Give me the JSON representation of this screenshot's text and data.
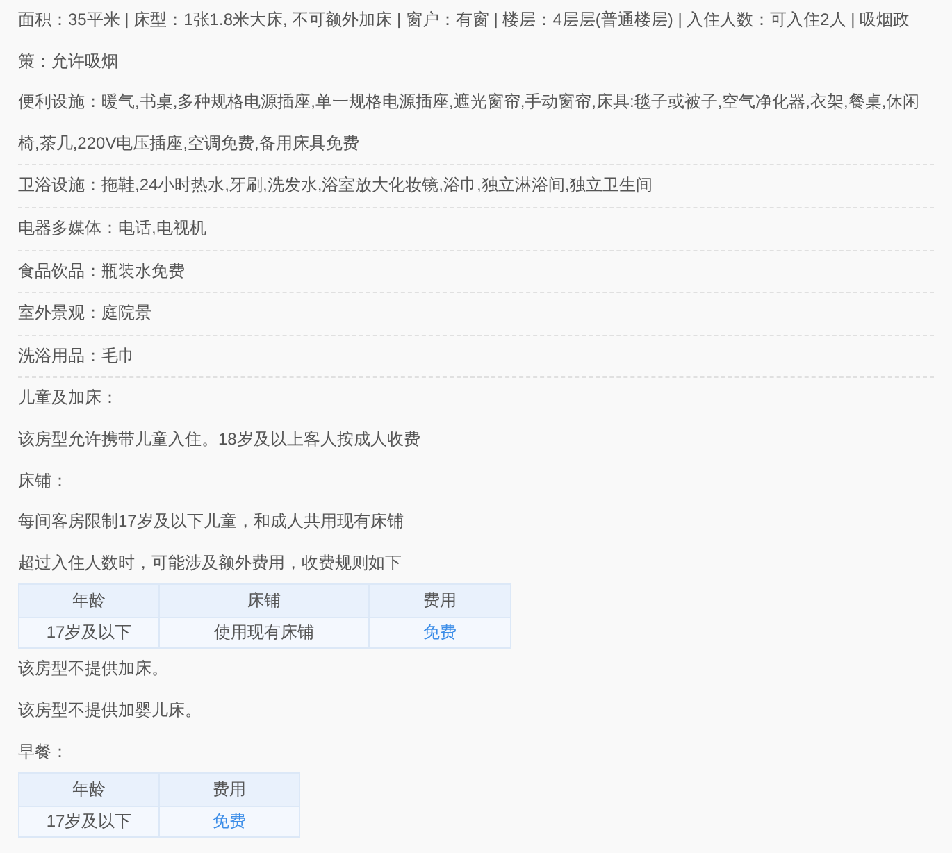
{
  "attributes": [
    {
      "text": "面积：35平米 | 床型：1张1.8米大床, 不可额外加床 | 窗户：有窗 | 楼层：4层层(普通楼层) | 入住人数：可入住2人 | 吸烟政策：允许吸烟"
    },
    {
      "text": "便利设施：暖气,书桌,多种规格电源插座,单一规格电源插座,遮光窗帘,手动窗帘,床具:毯子或被子,空气净化器,衣架,餐桌,休闲椅,茶几,220V电压插座,空调免费,备用床具免费"
    },
    {
      "text": "卫浴设施：拖鞋,24小时热水,牙刷,洗发水,浴室放大化妆镜,浴巾,独立淋浴间,独立卫生间"
    },
    {
      "text": "电器多媒体：电话,电视机"
    },
    {
      "text": "食品饮品：瓶装水免费"
    },
    {
      "text": "室外景观：庭院景"
    },
    {
      "text": "洗浴用品：毛巾"
    }
  ],
  "policy_blocks": [
    {
      "kind": "text",
      "text": "儿童及加床："
    },
    {
      "kind": "text",
      "text": "该房型允许携带儿童入住。18岁及以上客人按成人收费"
    },
    {
      "kind": "text",
      "text": "床铺："
    },
    {
      "kind": "text",
      "text": "每间客房限制17岁及以下儿童，和成人共用现有床铺"
    },
    {
      "kind": "text",
      "text": "超过入住人数时，可能涉及额外费用，收费规则如下"
    },
    {
      "kind": "table",
      "columns": [
        "年龄",
        "床铺",
        "费用"
      ],
      "rows": [
        [
          {
            "text": "17岁及以下",
            "highlight": false
          },
          {
            "text": "使用现有床铺",
            "highlight": false
          },
          {
            "text": "免费",
            "highlight": true
          }
        ]
      ]
    },
    {
      "kind": "text",
      "text": "该房型不提供加床。"
    },
    {
      "kind": "text",
      "text": "该房型不提供加婴儿床。"
    },
    {
      "kind": "text",
      "text": "早餐："
    },
    {
      "kind": "table",
      "columns": [
        "年龄",
        "费用"
      ],
      "rows": [
        [
          {
            "text": "17岁及以下",
            "highlight": false
          },
          {
            "text": "免费",
            "highlight": true
          }
        ]
      ]
    }
  ]
}
